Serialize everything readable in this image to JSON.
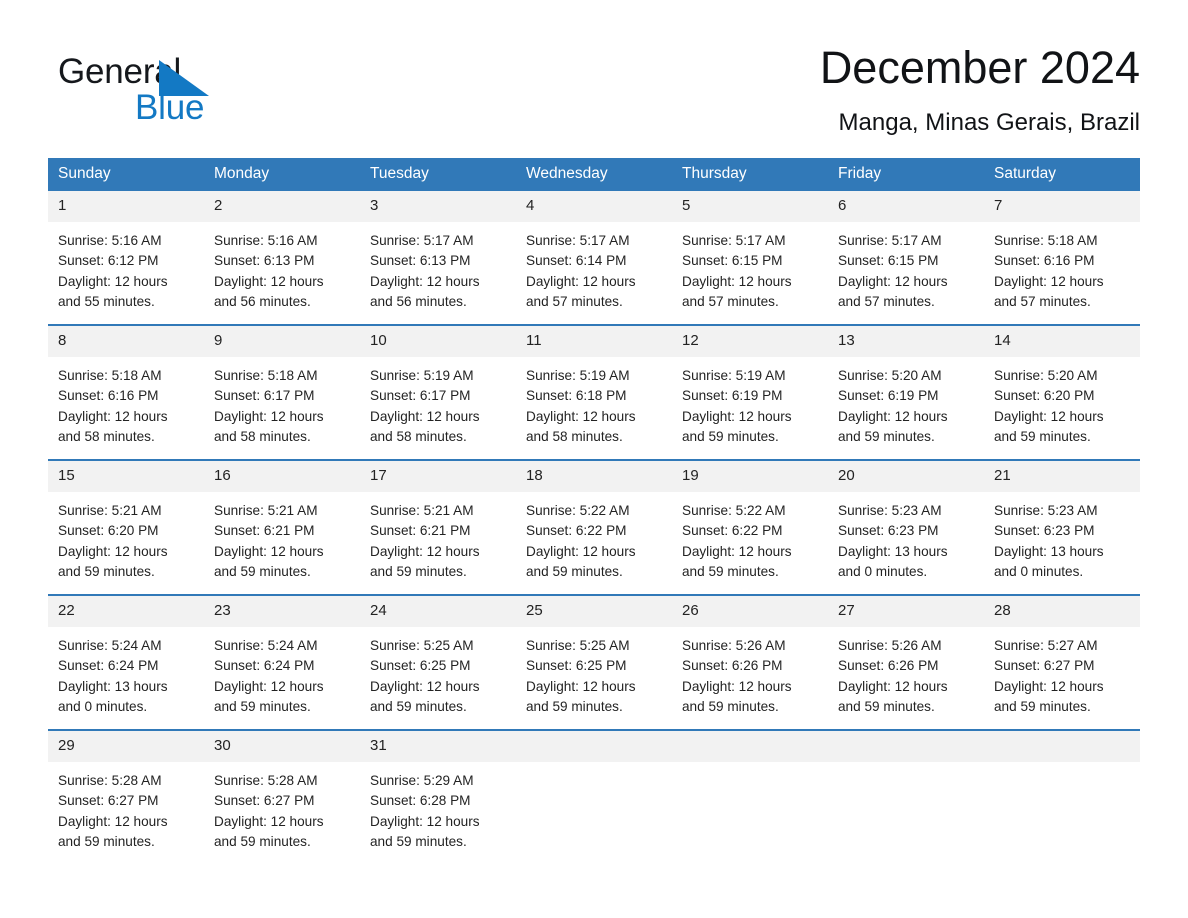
{
  "brand": {
    "name_part1": "General",
    "name_part2": "Blue",
    "triangle_color": "#1379c4",
    "accent_color": "#1379c4"
  },
  "header": {
    "month_title": "December 2024",
    "location": "Manga, Minas Gerais, Brazil"
  },
  "theme": {
    "header_blue": "#3179b8",
    "daynum_band": "#f2f2f2",
    "text": "#232323",
    "page_background": "#ffffff"
  },
  "calendar": {
    "weekday_headers": [
      "Sunday",
      "Monday",
      "Tuesday",
      "Wednesday",
      "Thursday",
      "Friday",
      "Saturday"
    ],
    "weeks": [
      [
        {
          "day": "1",
          "sunrise": "Sunrise: 5:16 AM",
          "sunset": "Sunset: 6:12 PM",
          "daylight_line1": "Daylight: 12 hours",
          "daylight_line2": "and 55 minutes."
        },
        {
          "day": "2",
          "sunrise": "Sunrise: 5:16 AM",
          "sunset": "Sunset: 6:13 PM",
          "daylight_line1": "Daylight: 12 hours",
          "daylight_line2": "and 56 minutes."
        },
        {
          "day": "3",
          "sunrise": "Sunrise: 5:17 AM",
          "sunset": "Sunset: 6:13 PM",
          "daylight_line1": "Daylight: 12 hours",
          "daylight_line2": "and 56 minutes."
        },
        {
          "day": "4",
          "sunrise": "Sunrise: 5:17 AM",
          "sunset": "Sunset: 6:14 PM",
          "daylight_line1": "Daylight: 12 hours",
          "daylight_line2": "and 57 minutes."
        },
        {
          "day": "5",
          "sunrise": "Sunrise: 5:17 AM",
          "sunset": "Sunset: 6:15 PM",
          "daylight_line1": "Daylight: 12 hours",
          "daylight_line2": "and 57 minutes."
        },
        {
          "day": "6",
          "sunrise": "Sunrise: 5:17 AM",
          "sunset": "Sunset: 6:15 PM",
          "daylight_line1": "Daylight: 12 hours",
          "daylight_line2": "and 57 minutes."
        },
        {
          "day": "7",
          "sunrise": "Sunrise: 5:18 AM",
          "sunset": "Sunset: 6:16 PM",
          "daylight_line1": "Daylight: 12 hours",
          "daylight_line2": "and 57 minutes."
        }
      ],
      [
        {
          "day": "8",
          "sunrise": "Sunrise: 5:18 AM",
          "sunset": "Sunset: 6:16 PM",
          "daylight_line1": "Daylight: 12 hours",
          "daylight_line2": "and 58 minutes."
        },
        {
          "day": "9",
          "sunrise": "Sunrise: 5:18 AM",
          "sunset": "Sunset: 6:17 PM",
          "daylight_line1": "Daylight: 12 hours",
          "daylight_line2": "and 58 minutes."
        },
        {
          "day": "10",
          "sunrise": "Sunrise: 5:19 AM",
          "sunset": "Sunset: 6:17 PM",
          "daylight_line1": "Daylight: 12 hours",
          "daylight_line2": "and 58 minutes."
        },
        {
          "day": "11",
          "sunrise": "Sunrise: 5:19 AM",
          "sunset": "Sunset: 6:18 PM",
          "daylight_line1": "Daylight: 12 hours",
          "daylight_line2": "and 58 minutes."
        },
        {
          "day": "12",
          "sunrise": "Sunrise: 5:19 AM",
          "sunset": "Sunset: 6:19 PM",
          "daylight_line1": "Daylight: 12 hours",
          "daylight_line2": "and 59 minutes."
        },
        {
          "day": "13",
          "sunrise": "Sunrise: 5:20 AM",
          "sunset": "Sunset: 6:19 PM",
          "daylight_line1": "Daylight: 12 hours",
          "daylight_line2": "and 59 minutes."
        },
        {
          "day": "14",
          "sunrise": "Sunrise: 5:20 AM",
          "sunset": "Sunset: 6:20 PM",
          "daylight_line1": "Daylight: 12 hours",
          "daylight_line2": "and 59 minutes."
        }
      ],
      [
        {
          "day": "15",
          "sunrise": "Sunrise: 5:21 AM",
          "sunset": "Sunset: 6:20 PM",
          "daylight_line1": "Daylight: 12 hours",
          "daylight_line2": "and 59 minutes."
        },
        {
          "day": "16",
          "sunrise": "Sunrise: 5:21 AM",
          "sunset": "Sunset: 6:21 PM",
          "daylight_line1": "Daylight: 12 hours",
          "daylight_line2": "and 59 minutes."
        },
        {
          "day": "17",
          "sunrise": "Sunrise: 5:21 AM",
          "sunset": "Sunset: 6:21 PM",
          "daylight_line1": "Daylight: 12 hours",
          "daylight_line2": "and 59 minutes."
        },
        {
          "day": "18",
          "sunrise": "Sunrise: 5:22 AM",
          "sunset": "Sunset: 6:22 PM",
          "daylight_line1": "Daylight: 12 hours",
          "daylight_line2": "and 59 minutes."
        },
        {
          "day": "19",
          "sunrise": "Sunrise: 5:22 AM",
          "sunset": "Sunset: 6:22 PM",
          "daylight_line1": "Daylight: 12 hours",
          "daylight_line2": "and 59 minutes."
        },
        {
          "day": "20",
          "sunrise": "Sunrise: 5:23 AM",
          "sunset": "Sunset: 6:23 PM",
          "daylight_line1": "Daylight: 13 hours",
          "daylight_line2": "and 0 minutes."
        },
        {
          "day": "21",
          "sunrise": "Sunrise: 5:23 AM",
          "sunset": "Sunset: 6:23 PM",
          "daylight_line1": "Daylight: 13 hours",
          "daylight_line2": "and 0 minutes."
        }
      ],
      [
        {
          "day": "22",
          "sunrise": "Sunrise: 5:24 AM",
          "sunset": "Sunset: 6:24 PM",
          "daylight_line1": "Daylight: 13 hours",
          "daylight_line2": "and 0 minutes."
        },
        {
          "day": "23",
          "sunrise": "Sunrise: 5:24 AM",
          "sunset": "Sunset: 6:24 PM",
          "daylight_line1": "Daylight: 12 hours",
          "daylight_line2": "and 59 minutes."
        },
        {
          "day": "24",
          "sunrise": "Sunrise: 5:25 AM",
          "sunset": "Sunset: 6:25 PM",
          "daylight_line1": "Daylight: 12 hours",
          "daylight_line2": "and 59 minutes."
        },
        {
          "day": "25",
          "sunrise": "Sunrise: 5:25 AM",
          "sunset": "Sunset: 6:25 PM",
          "daylight_line1": "Daylight: 12 hours",
          "daylight_line2": "and 59 minutes."
        },
        {
          "day": "26",
          "sunrise": "Sunrise: 5:26 AM",
          "sunset": "Sunset: 6:26 PM",
          "daylight_line1": "Daylight: 12 hours",
          "daylight_line2": "and 59 minutes."
        },
        {
          "day": "27",
          "sunrise": "Sunrise: 5:26 AM",
          "sunset": "Sunset: 6:26 PM",
          "daylight_line1": "Daylight: 12 hours",
          "daylight_line2": "and 59 minutes."
        },
        {
          "day": "28",
          "sunrise": "Sunrise: 5:27 AM",
          "sunset": "Sunset: 6:27 PM",
          "daylight_line1": "Daylight: 12 hours",
          "daylight_line2": "and 59 minutes."
        }
      ],
      [
        {
          "day": "29",
          "sunrise": "Sunrise: 5:28 AM",
          "sunset": "Sunset: 6:27 PM",
          "daylight_line1": "Daylight: 12 hours",
          "daylight_line2": "and 59 minutes."
        },
        {
          "day": "30",
          "sunrise": "Sunrise: 5:28 AM",
          "sunset": "Sunset: 6:27 PM",
          "daylight_line1": "Daylight: 12 hours",
          "daylight_line2": "and 59 minutes."
        },
        {
          "day": "31",
          "sunrise": "Sunrise: 5:29 AM",
          "sunset": "Sunset: 6:28 PM",
          "daylight_line1": "Daylight: 12 hours",
          "daylight_line2": "and 59 minutes."
        },
        {
          "day": "",
          "sunrise": "",
          "sunset": "",
          "daylight_line1": "",
          "daylight_line2": ""
        },
        {
          "day": "",
          "sunrise": "",
          "sunset": "",
          "daylight_line1": "",
          "daylight_line2": ""
        },
        {
          "day": "",
          "sunrise": "",
          "sunset": "",
          "daylight_line1": "",
          "daylight_line2": ""
        },
        {
          "day": "",
          "sunrise": "",
          "sunset": "",
          "daylight_line1": "",
          "daylight_line2": ""
        }
      ]
    ]
  }
}
